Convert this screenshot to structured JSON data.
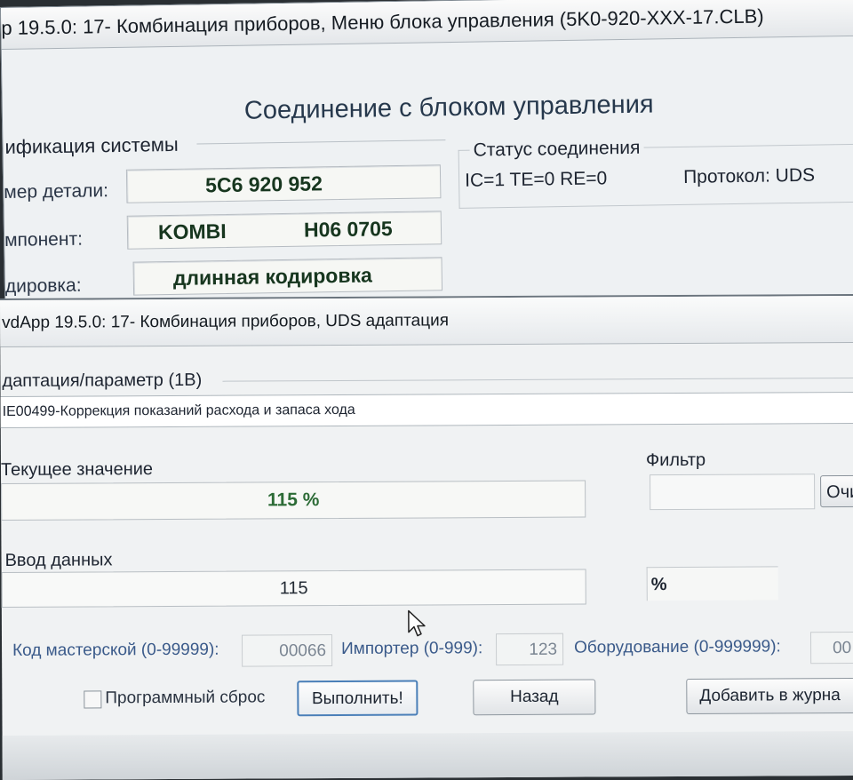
{
  "back_window": {
    "title": "p 19.5.0: 17- Комбинация приборов,  Меню блока управления (5K0-920-XXX-17.CLB)",
    "heading": "Соединение с блоком управления",
    "group_title": "ификация системы",
    "rows": [
      {
        "label": "мер детали:",
        "value_left": "5C6 920 952",
        "value_right": ""
      },
      {
        "label": "мпонент:",
        "value_left": "KOMBI",
        "value_right": "H06 0705"
      },
      {
        "label": "дировка:",
        "value_left": "длинная кодировка",
        "value_right": ""
      }
    ],
    "status": {
      "title": "Статус соединения",
      "text": "IC=1  TE=0   RE=0",
      "protocol": "Протокол: UDS"
    }
  },
  "front_window": {
    "title": "vdApp 19.5.0: 17- Комбинация приборов,  UDS адаптация",
    "adaptation_label": "даптация/параметр (1В)",
    "adaptation_value": "IE00499-Коррекция показаний расхода и запаса хода",
    "current_label": "Текущее значение",
    "current_value": "115 %",
    "filter_label": "Фильтр",
    "filter_value": "",
    "clear_button": "Очи",
    "entry_label": "Ввод данных",
    "entry_value": "115",
    "unit": "%",
    "fields": [
      {
        "label": "Код мастерской (0-99999):",
        "value": "00066"
      },
      {
        "label": "Импортер (0-999):",
        "value": "123"
      },
      {
        "label": "Оборудование (0-999999):",
        "value": "00"
      }
    ],
    "checkbox_label": "Программный сброс",
    "execute_button": "Выполнить!",
    "back_button": "Назад",
    "log_button": "Добавить в журна"
  }
}
